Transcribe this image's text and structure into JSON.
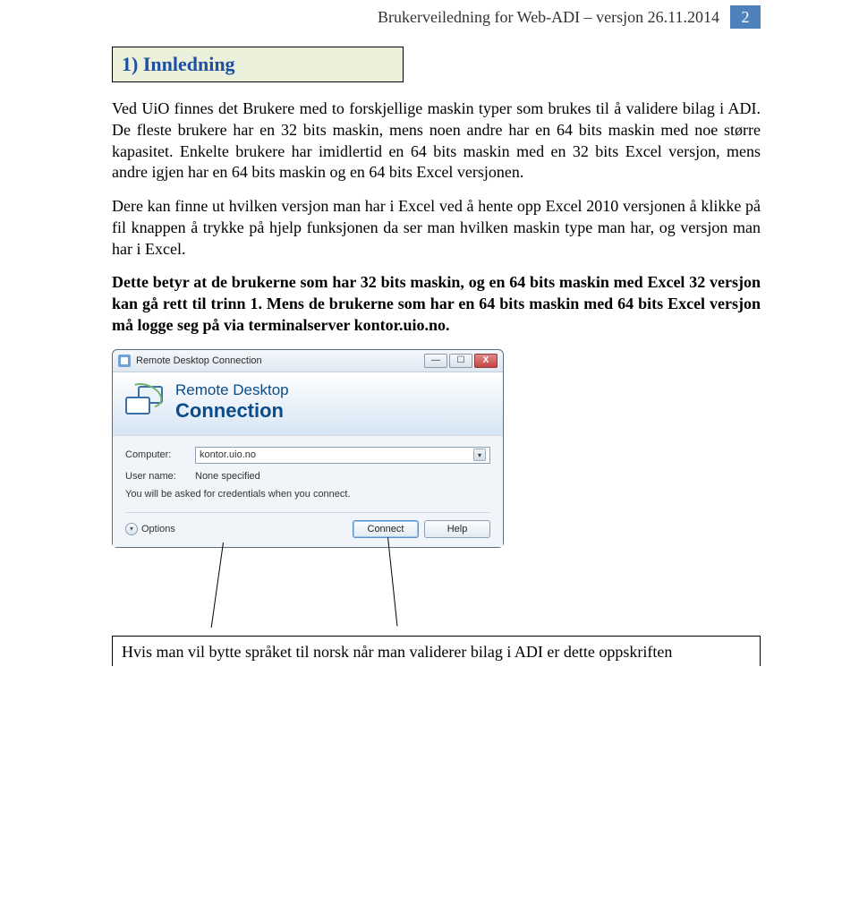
{
  "header": {
    "text": "Brukerveiledning for Web-ADI – versjon 26.11.2014",
    "page_number": "2"
  },
  "section_heading": "1) Innledning",
  "paragraphs": {
    "p1": "Ved UiO finnes det Brukere med to forskjellige maskin typer som brukes til å validere bilag i ADI. De fleste brukere har en 32 bits maskin, mens noen andre har en 64 bits maskin med noe større kapasitet. Enkelte brukere har imidlertid en 64 bits maskin med en 32 bits Excel versjon, mens andre igjen har en 64 bits maskin og en 64 bits Excel versjonen.",
    "p2": " Dere kan finne ut hvilken versjon man har i Excel ved å hente opp Excel 2010 versjonen å klikke på fil knappen å trykke på hjelp funksjonen da ser man hvilken maskin type man har, og versjon man har i Excel.",
    "p3": "Dette betyr at de brukerne som har 32 bits maskin, og en 64 bits maskin med Excel 32 versjon kan gå rett til trinn 1. Mens de brukerne som har en 64 bits maskin med 64 bits Excel versjon må logge seg på via terminalserver kontor.uio.no.",
    "footer": "Hvis man vil bytte språket til norsk når man validerer bilag i ADI er dette oppskriften"
  },
  "rdp": {
    "title": "Remote Desktop Connection",
    "banner_line1": "Remote Desktop",
    "banner_line2": "Connection",
    "computer_label": "Computer:",
    "computer_value": "kontor.uio.no",
    "username_label": "User name:",
    "username_value": "None specified",
    "note": "You will be asked for credentials when you connect.",
    "options_label": "Options",
    "connect_label": "Connect",
    "help_label": "Help"
  }
}
